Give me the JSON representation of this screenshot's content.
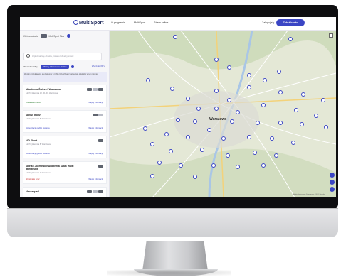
{
  "nav": {
    "logo": "MultiSport",
    "links": [
      "O programie ⌄",
      "MultiSport ⌄",
      "Strefa online ⌄"
    ],
    "login": "Zaloguj się",
    "signup": "Załóż konto"
  },
  "sidebar": {
    "card_selector_label": "Wybrana karta",
    "card_name": "MultiSport Plus",
    "search_placeholder": "Wpisz nazwę obiektu, miasto lub aktywność",
    "filters_label": "Wszystkie filtry",
    "filter_chip": "Obiekty Warszawa i okolice",
    "reset_label": "Wyczyść filtry",
    "notice": "Wyniki wyszukiwania są dostępne w trybie listy. Zobacz pełną listę obiektów w tym rejonie.",
    "facilities": [
      {
        "name": "Akademia Ćwiczeń Warszawa",
        "address": "ul. Przykładowa 12, 00-001 Warszawa",
        "status": "Otwarte do 22:00",
        "status_color": "#2e7d32",
        "more": "Więcej informacji"
      },
      {
        "name": "Active Body",
        "address": "ul. Przykładowa 5, Warszawa",
        "status": "Aktualizacja godzin otwarcia",
        "status_color": "#5c5c66",
        "more": "Więcej informacji"
      },
      {
        "name": "AD Sheet",
        "address": "ul. Przykładowa 8, Warszawa",
        "status": "Aktualizacja godzin otwarcia",
        "status_color": "#5c5c66",
        "more": "Więcej informacji"
      },
      {
        "name": "Adriko Józefińskie Akademia Sztuk Walki Bielańskie",
        "address": "ul. Przykładowa 3, Warszawa",
        "status": "Zamknięte teraz",
        "status_color": "#c62828",
        "more": "Więcej informacji"
      },
      {
        "name": "Aerosquad",
        "address": "",
        "status": "",
        "status_color": "#5c5c66",
        "more": ""
      }
    ]
  },
  "map": {
    "city_label": "Warszawa",
    "attribution": "Skróty klawiszowe  Dane mapy ©2023 Google",
    "accent": "#3b46c4"
  },
  "colors": {
    "accent": "#3b46c4",
    "nav_text": "#1f2a5c"
  }
}
